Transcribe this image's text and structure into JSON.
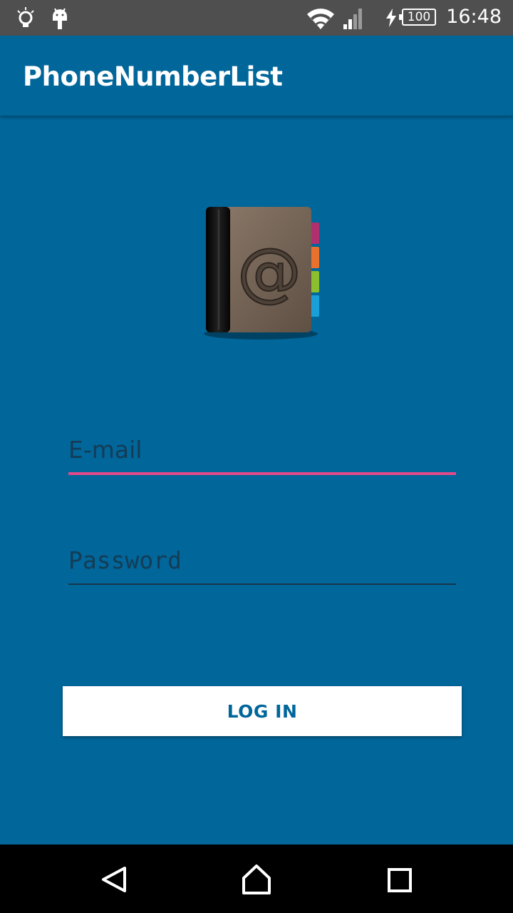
{
  "status_bar": {
    "time": "16:48",
    "battery": "100",
    "icons": [
      "lightbulb-icon",
      "android-icon",
      "wifi-icon",
      "cell-signal-icon",
      "charging-icon",
      "battery-icon"
    ]
  },
  "app_bar": {
    "title": "PhoneNumberList"
  },
  "logo": {
    "icon": "address-book-icon",
    "symbol": "@"
  },
  "form": {
    "email_placeholder": "E-mail",
    "password_placeholder": "Password",
    "login_label": "LOG IN"
  },
  "nav_bar": {
    "icons": [
      "back-icon",
      "home-icon",
      "recents-icon"
    ]
  },
  "colors": {
    "primary": "#01669a",
    "accent": "#e2498a",
    "status_bar": "#4f4f4f",
    "nav_bar": "#000000"
  }
}
